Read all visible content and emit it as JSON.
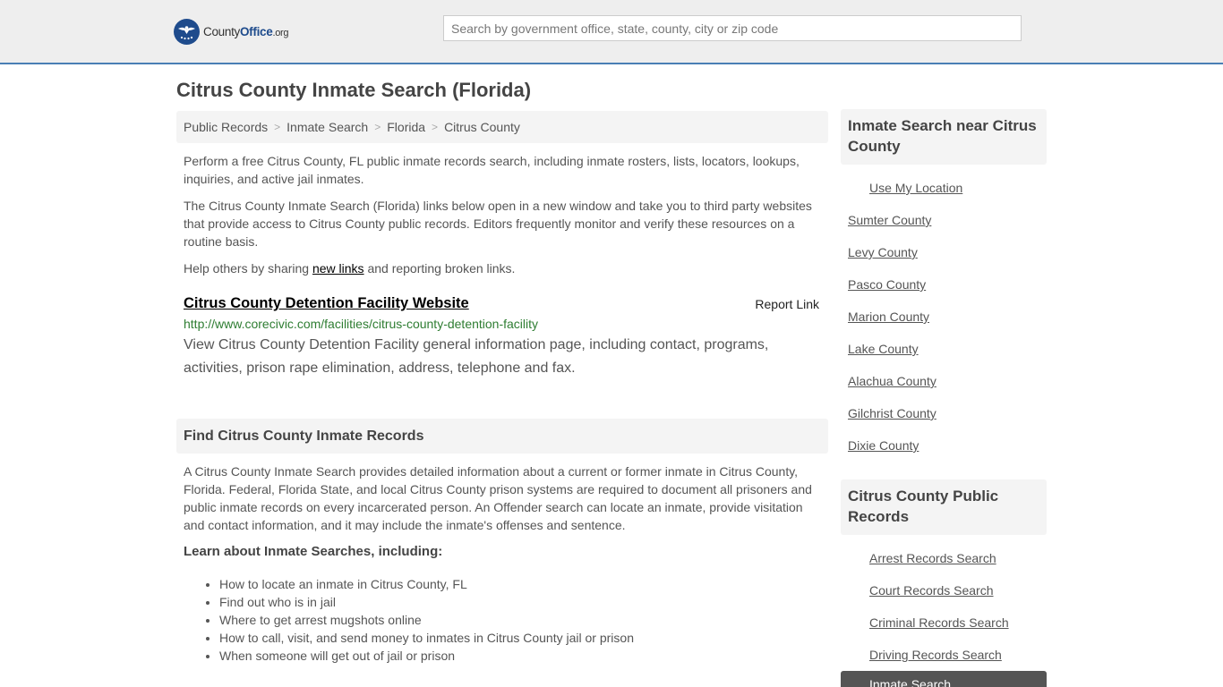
{
  "header": {
    "logo_part1": "County",
    "logo_part2": "Office",
    "logo_part3": ".org",
    "search_placeholder": "Search by government office, state, county, city or zip code"
  },
  "page_title": "Citrus County Inmate Search (Florida)",
  "breadcrumb": [
    "Public Records",
    "Inmate Search",
    "Florida",
    "Citrus County"
  ],
  "intro": {
    "p1": "Perform a free Citrus County, FL public inmate records search, including inmate rosters, lists, locators, lookups, inquiries, and active jail inmates.",
    "p2": "The Citrus County Inmate Search (Florida) links below open in a new window and take you to third party websites that provide access to Citrus County public records. Editors frequently monitor and verify these resources on a routine basis.",
    "p3_before": "Help others by sharing ",
    "p3_link": "new links",
    "p3_after": " and reporting broken links."
  },
  "result": {
    "title": "Citrus County Detention Facility Website",
    "report": "Report Link",
    "url": "http://www.corecivic.com/facilities/citrus-county-detention-facility",
    "desc": "View Citrus County Detention Facility general information page, including contact, programs, activities, prison rape elimination, address, telephone and fax."
  },
  "find": {
    "heading": "Find Citrus County Inmate Records",
    "para": "A Citrus County Inmate Search provides detailed information about a current or former inmate in Citrus County, Florida. Federal, Florida State, and local Citrus County prison systems are required to document all prisoners and public inmate records on every incarcerated person. An Offender search can locate an inmate, provide visitation and contact information, and it may include the inmate's offenses and sentence.",
    "learn_heading": "Learn about Inmate Searches, including:",
    "items": [
      "How to locate an inmate in Citrus County, FL",
      "Find out who is in jail",
      "Where to get arrest mugshots online",
      "How to call, visit, and send money to inmates in Citrus County jail or prison",
      "When someone will get out of jail or prison"
    ]
  },
  "sidebar_near": {
    "heading": "Inmate Search near Citrus County",
    "use_location": "Use My Location",
    "counties": [
      "Sumter County",
      "Levy County",
      "Pasco County",
      "Marion County",
      "Lake County",
      "Alachua County",
      "Gilchrist County",
      "Dixie County"
    ]
  },
  "sidebar_records": {
    "heading": "Citrus County Public Records",
    "items": [
      "Arrest Records Search",
      "Court Records Search",
      "Criminal Records Search",
      "Driving Records Search"
    ],
    "active": "Inmate Search"
  }
}
